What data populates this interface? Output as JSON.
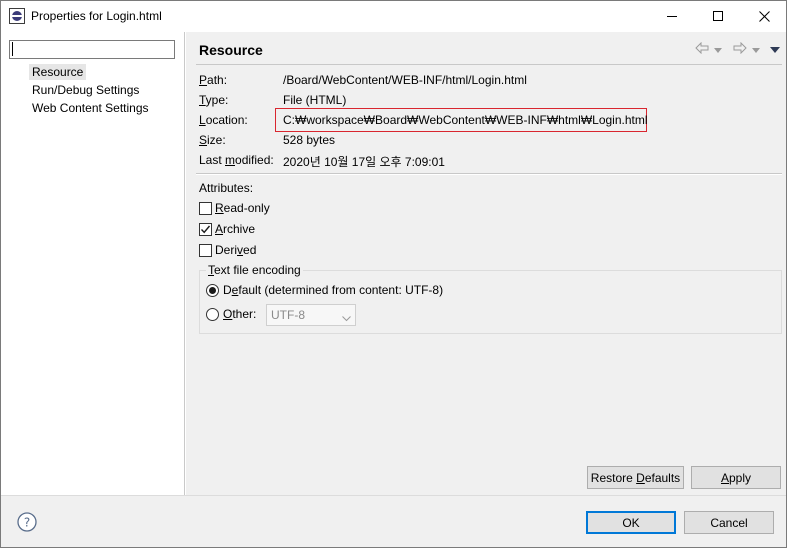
{
  "window": {
    "title": "Properties for Login.html"
  },
  "left": {
    "filter_value": "",
    "items": [
      {
        "label": "Resource"
      },
      {
        "label": "Run/Debug Settings"
      },
      {
        "label": "Web Content Settings"
      }
    ]
  },
  "page": {
    "title": "Resource",
    "properties": [
      {
        "label": "Path:",
        "value": "/Board/WebContent/WEB-INF/html/Login.html"
      },
      {
        "label": "Type:",
        "value": "File  (HTML)"
      },
      {
        "label": "Location:",
        "value": "C:₩workspace₩Board₩WebContent₩WEB-INF₩html₩Login.html"
      },
      {
        "label": "Size:",
        "value": "528  bytes"
      },
      {
        "label": "Last modified:",
        "value": "2020년 10월 17일 오후 7:09:01"
      }
    ],
    "attributes_label": "Attributes:",
    "attributes": [
      {
        "label": "Read-only",
        "checked": false
      },
      {
        "label": "Archive",
        "checked": true
      },
      {
        "label": "Derived",
        "checked": false
      }
    ],
    "encoding": {
      "group_label": "Text file encoding",
      "default_label": "Default (determined from content: UTF-8)",
      "other_label": "Other:",
      "selected": "default",
      "other_value": "UTF-8"
    },
    "restore_defaults": "Restore Defaults",
    "apply": "Apply"
  },
  "footer": {
    "ok": "OK",
    "cancel": "Cancel"
  },
  "icons": {
    "app": "eclipse-icon",
    "help": "help-icon",
    "back": "back-arrow-icon",
    "forward": "forward-arrow-icon",
    "menu": "view-menu-icon"
  },
  "colors": {
    "highlight": "#d9262f",
    "default_button_border": "#0078d7",
    "pane_background": "#f0f0f0"
  }
}
